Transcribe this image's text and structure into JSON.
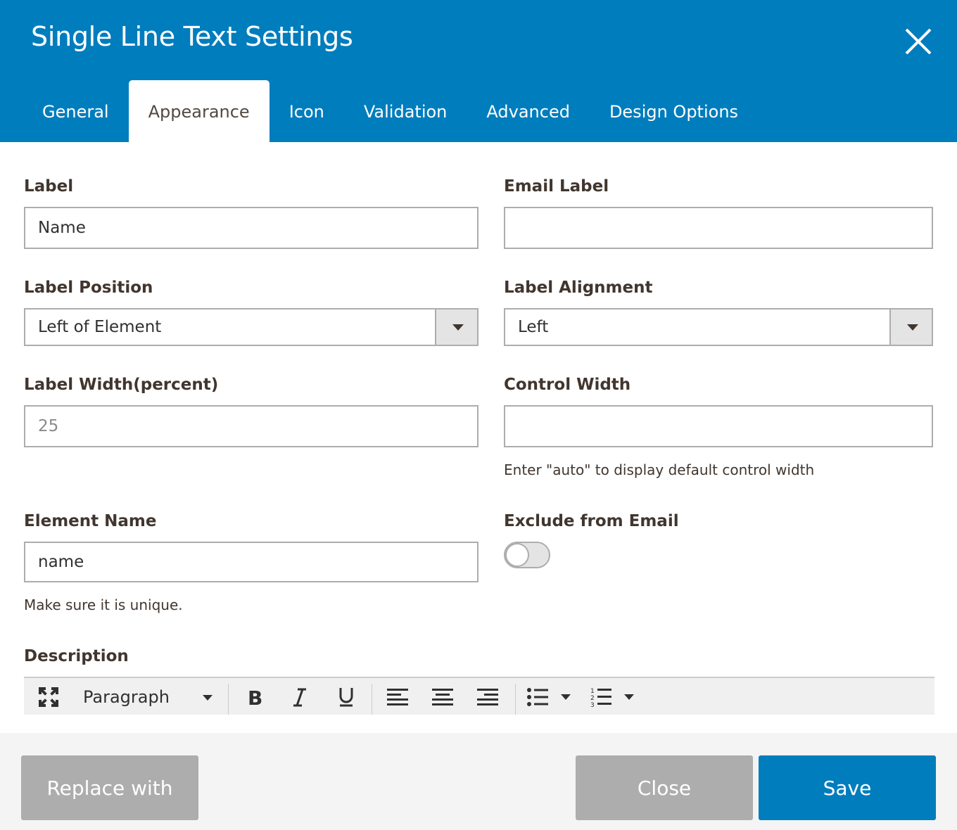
{
  "dialog": {
    "title": "Single Line Text Settings",
    "tabs": [
      {
        "label": "General"
      },
      {
        "label": "Appearance"
      },
      {
        "label": "Icon"
      },
      {
        "label": "Validation"
      },
      {
        "label": "Advanced"
      },
      {
        "label": "Design Options"
      }
    ],
    "active_tab": "Appearance"
  },
  "form": {
    "label": {
      "title": "Label",
      "value": "Name"
    },
    "email_label": {
      "title": "Email Label",
      "value": ""
    },
    "label_position": {
      "title": "Label Position",
      "value": "Left of Element"
    },
    "label_alignment": {
      "title": "Label Alignment",
      "value": "Left"
    },
    "label_width": {
      "title": "Label Width(percent)",
      "placeholder": "25"
    },
    "control_width": {
      "title": "Control Width",
      "value": "",
      "hint": "Enter \"auto\" to display default control width"
    },
    "element_name": {
      "title": "Element Name",
      "value": "name",
      "hint": "Make sure it is unique."
    },
    "exclude_from_email": {
      "title": "Exclude from Email",
      "checked": false
    },
    "description": {
      "title": "Description"
    }
  },
  "editor_toolbar": {
    "format_select": "Paragraph",
    "icons": [
      "fullscreen-icon",
      "bold-icon",
      "italic-icon",
      "underline-icon",
      "align-left-icon",
      "align-center-icon",
      "align-right-icon",
      "bullet-list-icon",
      "numbered-list-icon"
    ]
  },
  "footer": {
    "replace_label": "Replace with",
    "close_label": "Close",
    "save_label": "Save"
  },
  "colors": {
    "primary": "#007dbd",
    "button_grey": "#adadad",
    "text": "#41362f"
  }
}
